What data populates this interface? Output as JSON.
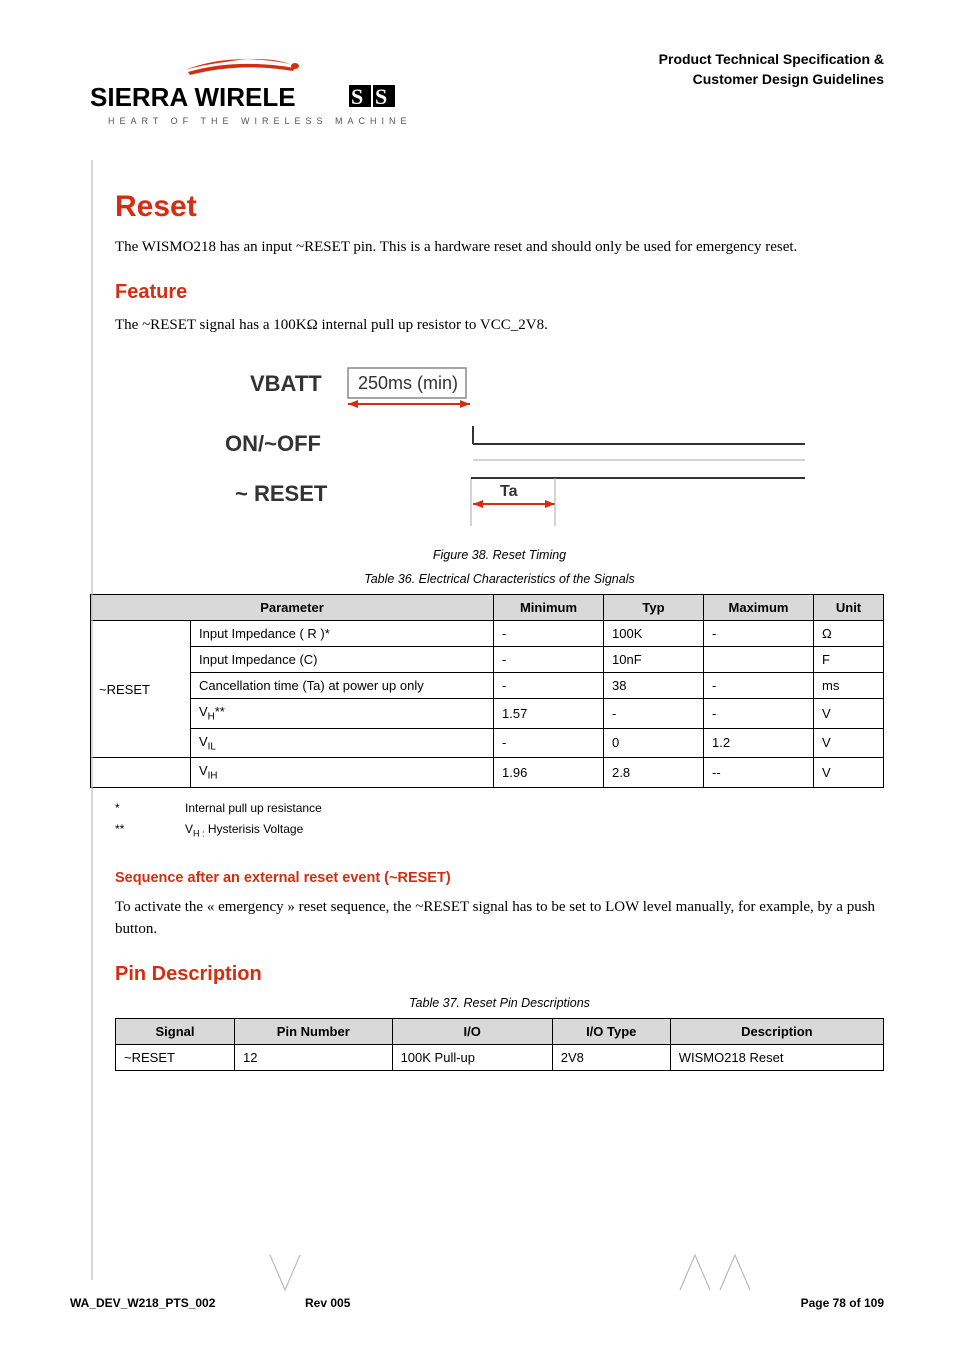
{
  "header": {
    "spec_line1": "Product Technical Specification &",
    "spec_line2": "Customer Design Guidelines",
    "logo_main": "SIERRA WIRELESS",
    "logo_tagline": "HEART OF THE WIRELESS MACHINE®"
  },
  "reset": {
    "title": "Reset",
    "intro": "The WISMO218 has an input ~RESET pin. This is a hardware reset and should only be used for emergency reset."
  },
  "feature": {
    "title": "Feature",
    "intro": "The ~RESET signal has a 100KΩ internal pull up resistor to VCC_2V8.",
    "diagram": {
      "vbatt": "VBATT",
      "onoff": "ON/~OFF",
      "reset": "~ RESET",
      "box_label": "250ms (min)",
      "ta": "Ta"
    },
    "fig_caption": "Figure 38. Reset Timing",
    "tbl_caption": "Table 36.    Electrical Characteristics of the Signals"
  },
  "chart_data": {
    "type": "table",
    "title": "Electrical Characteristics of the Signals",
    "columns": [
      "Parameter",
      "Minimum",
      "Typ",
      "Maximum",
      "Unit"
    ],
    "group_label": "~RESET",
    "rows": [
      {
        "param": "Input Impedance ( R )*",
        "min": "-",
        "typ": "100K",
        "max": "-",
        "unit": "Ω"
      },
      {
        "param": "Input Impedance (C)",
        "min": "-",
        "typ": "10nF",
        "max": "",
        "unit": "F"
      },
      {
        "param": "Cancellation time (Ta) at power up only",
        "min": "-",
        "typ": "38",
        "max": "-",
        "unit": "ms"
      },
      {
        "param": "V_H**",
        "min": "1.57",
        "typ": "-",
        "max": "-",
        "unit": "V"
      },
      {
        "param": "V_IL",
        "min": "-",
        "typ": "0",
        "max": "1.2",
        "unit": "V"
      },
      {
        "param": "V_IH",
        "min": "1.96",
        "typ": "2.8",
        "max": "--",
        "unit": "V"
      }
    ]
  },
  "footnotes": {
    "star": "*",
    "star_text": "Internal pull up resistance",
    "dstar": "**",
    "dstar_text_prefix": "V",
    "dstar_text_sub": "H :",
    "dstar_text_rest": " Hysterisis Voltage"
  },
  "sequence": {
    "heading": "Sequence after an external reset event (~RESET)",
    "para": "To activate the « emergency » reset sequence, the ~RESET signal has to be set to LOW level manually, for example, by a push button."
  },
  "pin_desc": {
    "title": "Pin Description",
    "tbl_caption": "Table 37.    Reset Pin Descriptions",
    "columns": [
      "Signal",
      "Pin Number",
      "I/O",
      "I/O Type",
      "Description"
    ],
    "row": {
      "signal": "~RESET",
      "pin": "12",
      "io": "100K Pull-up",
      "iotype": "2V8",
      "desc": "WISMO218 Reset"
    }
  },
  "footer": {
    "left": "WA_DEV_W218_PTS_002",
    "mid": "Rev 005",
    "right": "Page 78 of 109"
  }
}
